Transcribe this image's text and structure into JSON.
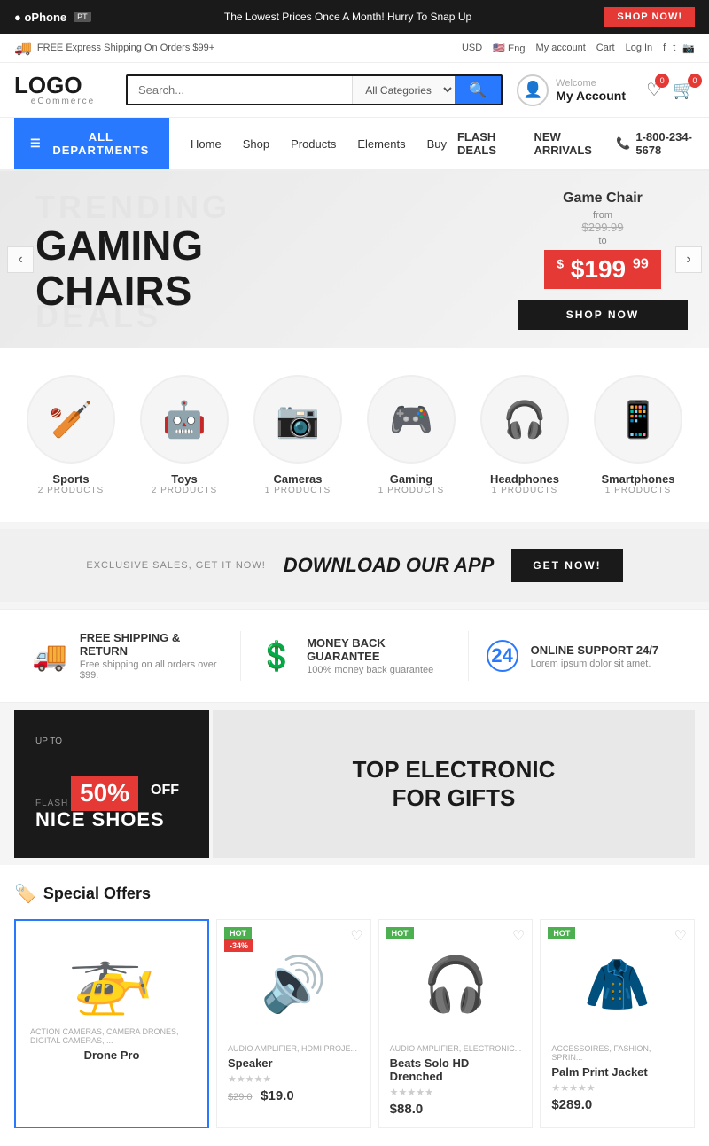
{
  "topBanner": {
    "logo": "oPhone",
    "logo_suffix": "PT",
    "promo_text": "The Lowest Prices Once A Month! Hurry To Snap Up",
    "shop_now": "SHOP NOW!"
  },
  "utilityBar": {
    "shipping_text": "FREE Express Shipping On Orders $99+",
    "currency": "USD",
    "language": "Eng",
    "my_account": "My account",
    "cart": "Cart",
    "log_in": "Log In"
  },
  "header": {
    "logo_text": "LOGO",
    "logo_sub": "eCommerce",
    "search_placeholder": "Search...",
    "search_category": "All Categories",
    "welcome": "Welcome",
    "account_name": "My Account"
  },
  "nav": {
    "all_departments": "ALL DEPARTMENTS",
    "links": [
      "Home",
      "Shop",
      "Products",
      "Elements",
      "Buy"
    ],
    "flash_deals": "FLASH DEALS",
    "new_arrivals": "NEW ARRIVALS",
    "phone": "1-800-234-5678"
  },
  "hero": {
    "trending_text": "TRENDING",
    "title_line1": "GAMING",
    "title_line2": "CHAIRS",
    "deals_text": "DEALS",
    "product_name": "Game Chair",
    "from_label": "from",
    "old_price": "$299.99",
    "to_label": "to",
    "price_main": "$199",
    "price_cents": "99",
    "shop_now": "SHOP NOW"
  },
  "categories": [
    {
      "name": "Sports",
      "count": "2 PRODUCTS",
      "icon": "🏏"
    },
    {
      "name": "Toys",
      "count": "2 PRODUCTS",
      "icon": "🤖"
    },
    {
      "name": "Cameras",
      "count": "1 PRODUCTS",
      "icon": "📷"
    },
    {
      "name": "Gaming",
      "count": "1 PRODUCTS",
      "icon": "🎮"
    },
    {
      "name": "Headphones",
      "count": "1 PRODUCTS",
      "icon": "🎧"
    },
    {
      "name": "Smartphones",
      "count": "1 PRODUCTS",
      "icon": "📱"
    }
  ],
  "appBanner": {
    "exclusive": "EXCLUSIVE SALES, GET IT NOW!",
    "download": "DOWNLOAD OUR APP",
    "get_now": "GET NOW!"
  },
  "features": [
    {
      "icon": "🚚",
      "title": "FREE SHIPPING & RETURN",
      "desc": "Free shipping on all orders over $99."
    },
    {
      "icon": "💲",
      "title": "MONEY BACK GUARANTEE",
      "desc": "100% money back guarantee"
    },
    {
      "icon": "🕐",
      "title": "ONLINE SUPPORT 24/7",
      "desc": "Lorem ipsum dolor sit amet."
    }
  ],
  "promo": {
    "upto": "UP TO",
    "percent": "50%",
    "off": "OFF",
    "flash_sales": "FLASH SALES ON",
    "product": "NICE SHOES",
    "right_title_line1": "TOP ELECTRONIC",
    "right_title_line2": "FOR GIFTS"
  },
  "specialOffers": {
    "section_title": "Special Offers",
    "featured": {
      "category": "ACTION CAMERAS, CAMERA DRONES, DIGITAL CAMERAS, ...",
      "name": "Drone Pro",
      "icon": "🚁"
    },
    "products": [
      {
        "badge": "HOT",
        "discount": "-34%",
        "category": "AUDIO AMPLIFIER, HDMI PROJE...",
        "name": "Speaker",
        "old_price": "$29.0",
        "price": "$19.0",
        "icon": "🔊",
        "stars": "★★★★★"
      },
      {
        "badge": "HOT",
        "discount": "",
        "category": "AUDIO AMPLIFIER, ELECTRONIC...",
        "name": "Beats Solo HD Drenched",
        "price": "$88.0",
        "icon": "🎧",
        "stars": "★★★★★"
      },
      {
        "badge": "HOT",
        "discount": "",
        "category": "ACCESSOIRES, FASHION, SPRIN...",
        "name": "Palm Print Jacket",
        "price": "$289.0",
        "icon": "🧥",
        "stars": "★★★★★"
      }
    ]
  },
  "wishlist_count": "0",
  "cart_count": "0"
}
